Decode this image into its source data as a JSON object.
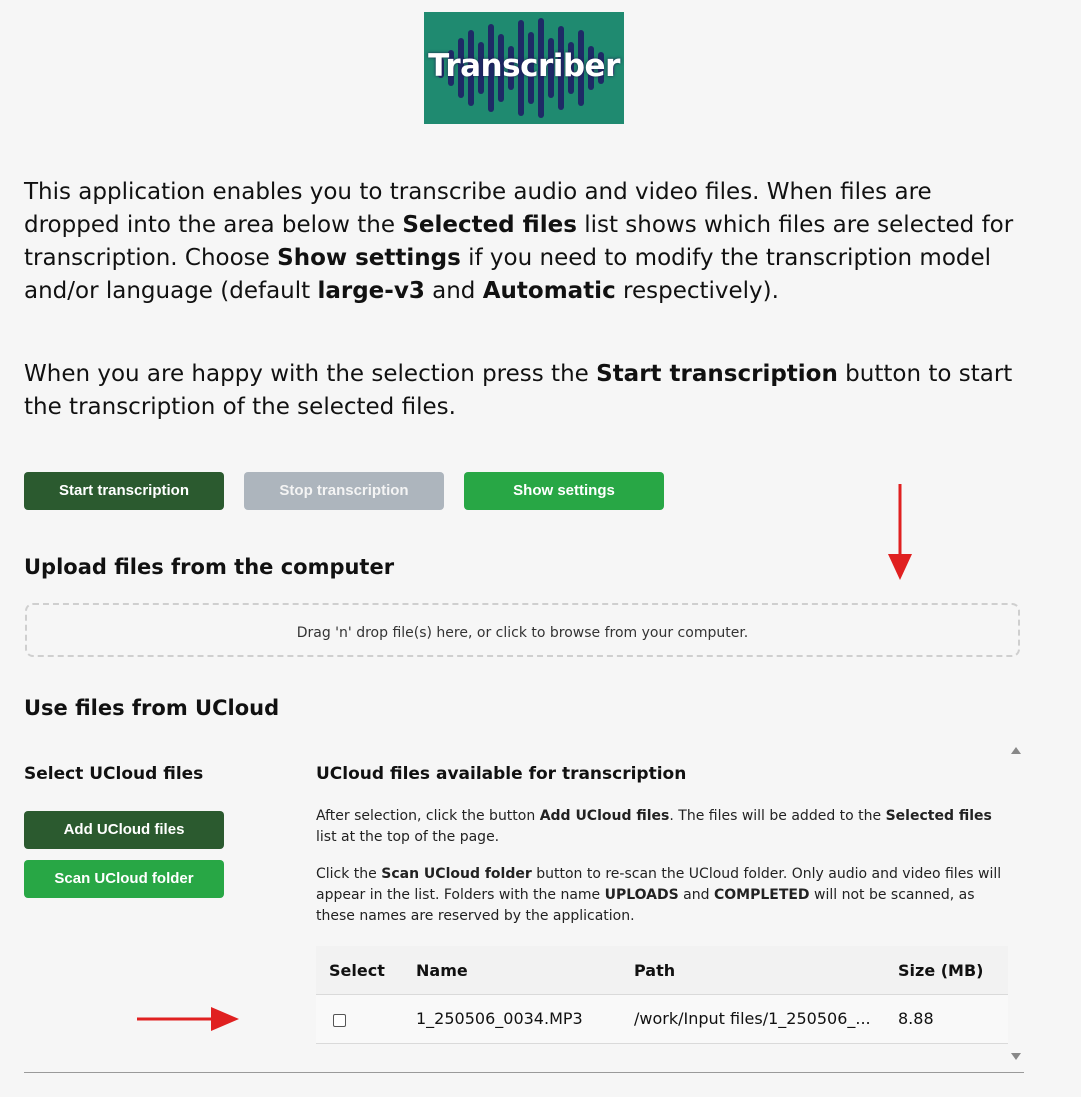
{
  "logo": {
    "text": "Transcriber"
  },
  "intro": {
    "p1": [
      {
        "t": "This application enables you to transcribe audio and video files. When files are dropped into the area below the ",
        "b": false
      },
      {
        "t": "Selected files",
        "b": true
      },
      {
        "t": " list shows which files are selected for transcription. Choose ",
        "b": false
      },
      {
        "t": "Show settings",
        "b": true
      },
      {
        "t": " if you need to modify the transcription model and/or language (default ",
        "b": false
      },
      {
        "t": "large-v3",
        "b": true
      },
      {
        "t": " and ",
        "b": false
      },
      {
        "t": "Automatic",
        "b": true
      },
      {
        "t": " respectively).",
        "b": false
      }
    ],
    "p2": [
      {
        "t": "When you are happy with the selection press the ",
        "b": false
      },
      {
        "t": "Start transcription",
        "b": true
      },
      {
        "t": " button to start the transcription of the selected files.",
        "b": false
      }
    ]
  },
  "buttons": {
    "start": "Start transcription",
    "stop": "Stop transcription",
    "settings": "Show settings"
  },
  "upload": {
    "heading": "Upload files from the computer",
    "dropzone_text": "Drag 'n' drop file(s) here, or click to browse from your computer."
  },
  "ucloud": {
    "heading": "Use files from UCloud",
    "select_heading": "Select UCloud files",
    "add_button": "Add UCloud files",
    "scan_button": "Scan UCloud folder",
    "available_heading": "UCloud files available for transcription",
    "p1": [
      {
        "t": "After selection, click the button ",
        "b": false
      },
      {
        "t": "Add UCloud files",
        "b": true
      },
      {
        "t": ". The files will be added to the ",
        "b": false
      },
      {
        "t": "Selected files",
        "b": true
      },
      {
        "t": " list at the top of the page.",
        "b": false
      }
    ],
    "p2": [
      {
        "t": "Click the ",
        "b": false
      },
      {
        "t": "Scan UCloud folder",
        "b": true
      },
      {
        "t": " button to re-scan the UCloud folder. Only audio and video files will appear in the list. Folders with the name ",
        "b": false
      },
      {
        "t": "UPLOADS",
        "b": true
      },
      {
        "t": " and ",
        "b": false
      },
      {
        "t": "COMPLETED",
        "b": true
      },
      {
        "t": " will not be scanned, as these names are reserved by the application.",
        "b": false
      }
    ],
    "table": {
      "columns": [
        "Select",
        "Name",
        "Path",
        "Size (MB)"
      ],
      "rows": [
        {
          "selected": false,
          "name": "1_250506_0034.MP3",
          "path": "/work/Input files/1_250506_...",
          "size": "8.88"
        }
      ]
    }
  },
  "colors": {
    "dark_green": "#2b5a2f",
    "green": "#28a745",
    "gray": "#adb5bd",
    "logo_bg": "#1f8a70",
    "annotation_arrow": "#e02020"
  }
}
